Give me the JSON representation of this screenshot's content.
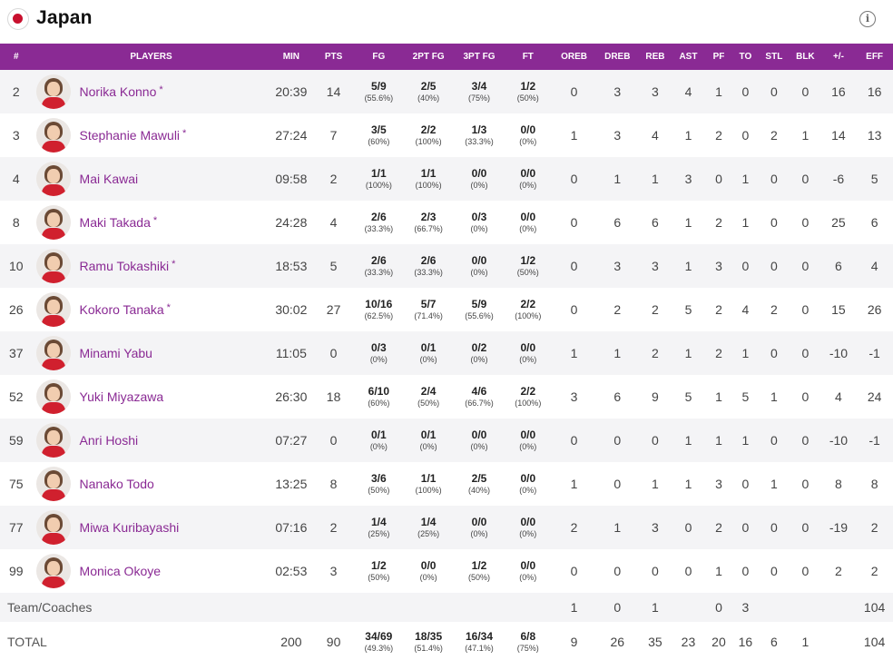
{
  "team": {
    "name": "Japan",
    "flag_icon": "japan-flag-icon",
    "info_icon": "info-icon"
  },
  "colors": {
    "header_bg": "#8a2a94",
    "player_link": "#8a2a94",
    "row_alt": "#f4f4f6"
  },
  "columns": [
    "#",
    "PLAYERS",
    "MIN",
    "PTS",
    "FG",
    "2PT FG",
    "3PT FG",
    "FT",
    "OREB",
    "DREB",
    "REB",
    "AST",
    "PF",
    "TO",
    "STL",
    "BLK",
    "+/-",
    "EFF"
  ],
  "players": [
    {
      "no": "2",
      "name": "Norika Konno",
      "star": "*",
      "min": "20:39",
      "pts": "14",
      "fg": "5/9",
      "fg_pct": "(55.6%)",
      "fg2": "2/5",
      "fg2_pct": "(40%)",
      "fg3": "3/4",
      "fg3_pct": "(75%)",
      "ft": "1/2",
      "ft_pct": "(50%)",
      "oreb": "0",
      "dreb": "3",
      "reb": "3",
      "ast": "4",
      "pf": "1",
      "to": "0",
      "stl": "0",
      "blk": "0",
      "pm": "16",
      "eff": "16"
    },
    {
      "no": "3",
      "name": "Stephanie Mawuli",
      "star": "*",
      "min": "27:24",
      "pts": "7",
      "fg": "3/5",
      "fg_pct": "(60%)",
      "fg2": "2/2",
      "fg2_pct": "(100%)",
      "fg3": "1/3",
      "fg3_pct": "(33.3%)",
      "ft": "0/0",
      "ft_pct": "(0%)",
      "oreb": "1",
      "dreb": "3",
      "reb": "4",
      "ast": "1",
      "pf": "2",
      "to": "0",
      "stl": "2",
      "blk": "1",
      "pm": "14",
      "eff": "13"
    },
    {
      "no": "4",
      "name": "Mai Kawai",
      "star": "",
      "min": "09:58",
      "pts": "2",
      "fg": "1/1",
      "fg_pct": "(100%)",
      "fg2": "1/1",
      "fg2_pct": "(100%)",
      "fg3": "0/0",
      "fg3_pct": "(0%)",
      "ft": "0/0",
      "ft_pct": "(0%)",
      "oreb": "0",
      "dreb": "1",
      "reb": "1",
      "ast": "3",
      "pf": "0",
      "to": "1",
      "stl": "0",
      "blk": "0",
      "pm": "-6",
      "eff": "5"
    },
    {
      "no": "8",
      "name": "Maki Takada",
      "star": "*",
      "min": "24:28",
      "pts": "4",
      "fg": "2/6",
      "fg_pct": "(33.3%)",
      "fg2": "2/3",
      "fg2_pct": "(66.7%)",
      "fg3": "0/3",
      "fg3_pct": "(0%)",
      "ft": "0/0",
      "ft_pct": "(0%)",
      "oreb": "0",
      "dreb": "6",
      "reb": "6",
      "ast": "1",
      "pf": "2",
      "to": "1",
      "stl": "0",
      "blk": "0",
      "pm": "25",
      "eff": "6"
    },
    {
      "no": "10",
      "name": "Ramu Tokashiki",
      "star": "*",
      "min": "18:53",
      "pts": "5",
      "fg": "2/6",
      "fg_pct": "(33.3%)",
      "fg2": "2/6",
      "fg2_pct": "(33.3%)",
      "fg3": "0/0",
      "fg3_pct": "(0%)",
      "ft": "1/2",
      "ft_pct": "(50%)",
      "oreb": "0",
      "dreb": "3",
      "reb": "3",
      "ast": "1",
      "pf": "3",
      "to": "0",
      "stl": "0",
      "blk": "0",
      "pm": "6",
      "eff": "4"
    },
    {
      "no": "26",
      "name": "Kokoro Tanaka",
      "star": "*",
      "min": "30:02",
      "pts": "27",
      "fg": "10/16",
      "fg_pct": "(62.5%)",
      "fg2": "5/7",
      "fg2_pct": "(71.4%)",
      "fg3": "5/9",
      "fg3_pct": "(55.6%)",
      "ft": "2/2",
      "ft_pct": "(100%)",
      "oreb": "0",
      "dreb": "2",
      "reb": "2",
      "ast": "5",
      "pf": "2",
      "to": "4",
      "stl": "2",
      "blk": "0",
      "pm": "15",
      "eff": "26"
    },
    {
      "no": "37",
      "name": "Minami Yabu",
      "star": "",
      "min": "11:05",
      "pts": "0",
      "fg": "0/3",
      "fg_pct": "(0%)",
      "fg2": "0/1",
      "fg2_pct": "(0%)",
      "fg3": "0/2",
      "fg3_pct": "(0%)",
      "ft": "0/0",
      "ft_pct": "(0%)",
      "oreb": "1",
      "dreb": "1",
      "reb": "2",
      "ast": "1",
      "pf": "2",
      "to": "1",
      "stl": "0",
      "blk": "0",
      "pm": "-10",
      "eff": "-1"
    },
    {
      "no": "52",
      "name": "Yuki Miyazawa",
      "star": "",
      "min": "26:30",
      "pts": "18",
      "fg": "6/10",
      "fg_pct": "(60%)",
      "fg2": "2/4",
      "fg2_pct": "(50%)",
      "fg3": "4/6",
      "fg3_pct": "(66.7%)",
      "ft": "2/2",
      "ft_pct": "(100%)",
      "oreb": "3",
      "dreb": "6",
      "reb": "9",
      "ast": "5",
      "pf": "1",
      "to": "5",
      "stl": "1",
      "blk": "0",
      "pm": "4",
      "eff": "24"
    },
    {
      "no": "59",
      "name": "Anri Hoshi",
      "star": "",
      "min": "07:27",
      "pts": "0",
      "fg": "0/1",
      "fg_pct": "(0%)",
      "fg2": "0/1",
      "fg2_pct": "(0%)",
      "fg3": "0/0",
      "fg3_pct": "(0%)",
      "ft": "0/0",
      "ft_pct": "(0%)",
      "oreb": "0",
      "dreb": "0",
      "reb": "0",
      "ast": "1",
      "pf": "1",
      "to": "1",
      "stl": "0",
      "blk": "0",
      "pm": "-10",
      "eff": "-1"
    },
    {
      "no": "75",
      "name": "Nanako Todo",
      "star": "",
      "min": "13:25",
      "pts": "8",
      "fg": "3/6",
      "fg_pct": "(50%)",
      "fg2": "1/1",
      "fg2_pct": "(100%)",
      "fg3": "2/5",
      "fg3_pct": "(40%)",
      "ft": "0/0",
      "ft_pct": "(0%)",
      "oreb": "1",
      "dreb": "0",
      "reb": "1",
      "ast": "1",
      "pf": "3",
      "to": "0",
      "stl": "1",
      "blk": "0",
      "pm": "8",
      "eff": "8"
    },
    {
      "no": "77",
      "name": "Miwa Kuribayashi",
      "star": "",
      "min": "07:16",
      "pts": "2",
      "fg": "1/4",
      "fg_pct": "(25%)",
      "fg2": "1/4",
      "fg2_pct": "(25%)",
      "fg3": "0/0",
      "fg3_pct": "(0%)",
      "ft": "0/0",
      "ft_pct": "(0%)",
      "oreb": "2",
      "dreb": "1",
      "reb": "3",
      "ast": "0",
      "pf": "2",
      "to": "0",
      "stl": "0",
      "blk": "0",
      "pm": "-19",
      "eff": "2"
    },
    {
      "no": "99",
      "name": "Monica Okoye",
      "star": "",
      "min": "02:53",
      "pts": "3",
      "fg": "1/2",
      "fg_pct": "(50%)",
      "fg2": "0/0",
      "fg2_pct": "(0%)",
      "fg3": "1/2",
      "fg3_pct": "(50%)",
      "ft": "0/0",
      "ft_pct": "(0%)",
      "oreb": "0",
      "dreb": "0",
      "reb": "0",
      "ast": "0",
      "pf": "1",
      "to": "0",
      "stl": "0",
      "blk": "0",
      "pm": "2",
      "eff": "2"
    }
  ],
  "team_coaches": {
    "label": "Team/Coaches",
    "oreb": "1",
    "dreb": "0",
    "reb": "1",
    "ast": "",
    "pf": "0",
    "to": "3",
    "stl": "",
    "blk": "",
    "pm": "",
    "eff": "104"
  },
  "total": {
    "label": "TOTAL",
    "min": "200",
    "pts": "90",
    "fg": "34/69",
    "fg_pct": "(49.3%)",
    "fg2": "18/35",
    "fg2_pct": "(51.4%)",
    "fg3": "16/34",
    "fg3_pct": "(47.1%)",
    "ft": "6/8",
    "ft_pct": "(75%)",
    "oreb": "9",
    "dreb": "26",
    "reb": "35",
    "ast": "23",
    "pf": "20",
    "to": "16",
    "stl": "6",
    "blk": "1",
    "pm": "",
    "eff": "104"
  }
}
